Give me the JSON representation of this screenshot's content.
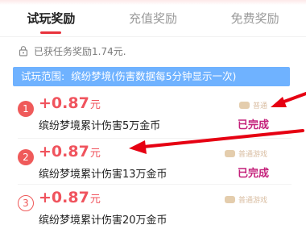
{
  "tabs": [
    {
      "label": "试玩奖励",
      "active": true
    },
    {
      "label": "充值奖励",
      "active": false
    },
    {
      "label": "免费奖励",
      "active": false
    }
  ],
  "reward_total": {
    "icon": "lock-icon",
    "text": "已获任务奖励1.74元."
  },
  "scope": {
    "label": "试玩范围:",
    "game": "缤纷梦境(伤害数据每5分钟显示一次)"
  },
  "tasks": [
    {
      "index": "1",
      "reward": "+0.87",
      "unit": "元",
      "desc": "缤纷梦境累计伤害5万金币",
      "badge": "普通",
      "status": "已完成",
      "marker": "filled"
    },
    {
      "index": "2",
      "reward": "+0.87",
      "unit": "元",
      "desc": "缤纷梦境累计伤害13万金币",
      "badge": "普通游戏",
      "status": "已完成",
      "marker": "filled"
    },
    {
      "index": "3",
      "reward": "+0.87",
      "unit": "元",
      "desc": "缤纷梦境累计伤害20万金币",
      "badge": "普通游戏",
      "status": "",
      "marker": "outline"
    }
  ],
  "colors": {
    "accent": "#e8323c",
    "reward": "#f0545e",
    "completed": "#c4207a",
    "scope_bg": "#6fb2ff",
    "arrow": "#e60012"
  }
}
